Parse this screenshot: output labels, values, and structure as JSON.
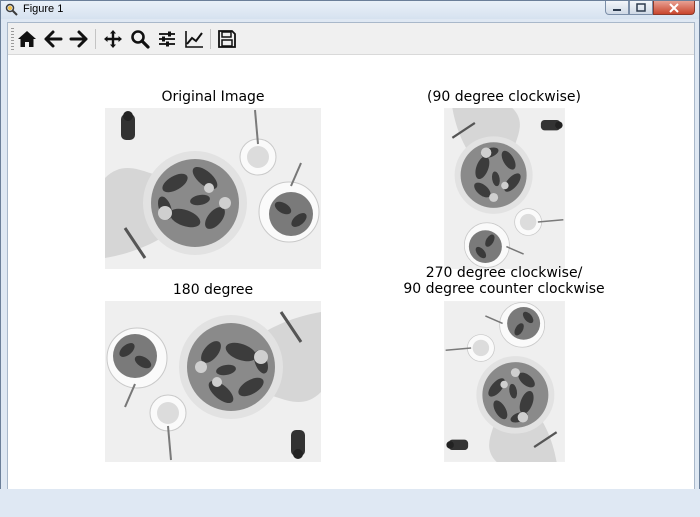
{
  "window": {
    "title": "Figure 1"
  },
  "toolbar": {
    "buttons": [
      {
        "name": "home-icon"
      },
      {
        "name": "back-arrow-icon"
      },
      {
        "name": "forward-arrow-icon"
      },
      {
        "name": "pan-move-icon"
      },
      {
        "name": "zoom-magnifier-icon"
      },
      {
        "name": "configure-subplots-icon"
      },
      {
        "name": "edit-axis-curves-icon"
      },
      {
        "name": "save-floppy-icon"
      }
    ]
  },
  "subplots": [
    {
      "title": "Original Image"
    },
    {
      "title": "(90 degree clockwise)"
    },
    {
      "title": "180 degree"
    },
    {
      "title_line1": "270 degree clockwise/",
      "title_line2": "90 degree counter clockwise"
    }
  ]
}
